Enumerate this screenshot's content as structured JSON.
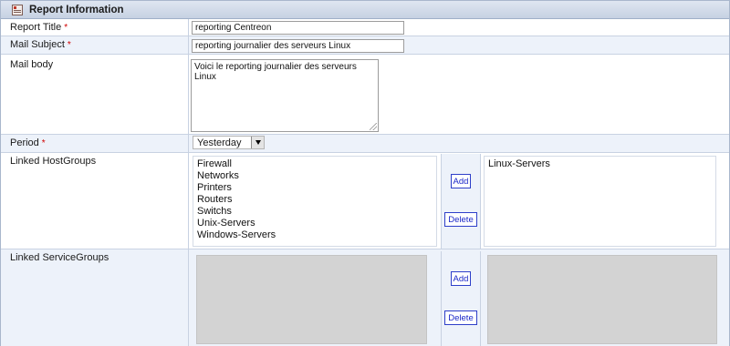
{
  "section": {
    "title": "Report Information",
    "icon": "report-icon"
  },
  "fields": {
    "report_title": {
      "label": "Report Title",
      "required": "*",
      "value": "reporting Centreon"
    },
    "mail_subject": {
      "label": "Mail Subject",
      "required": "*",
      "value": "reporting journalier des serveurs Linux"
    },
    "mail_body": {
      "label": "Mail body",
      "value": "Voici le reporting journalier des serveurs Linux"
    },
    "period": {
      "label": "Period",
      "required": "*",
      "value": "Yesterday"
    }
  },
  "hostgroups": {
    "label": "Linked HostGroups",
    "available": [
      "Firewall",
      "Networks",
      "Printers",
      "Routers",
      "Switchs",
      "Unix-Servers",
      "Windows-Servers"
    ],
    "selected": [
      "Linux-Servers"
    ],
    "add_label": "Add",
    "delete_label": "Delete"
  },
  "servicegroups": {
    "label": "Linked ServiceGroups",
    "available": [],
    "selected": [],
    "add_label": "Add",
    "delete_label": "Delete"
  },
  "colors": {
    "required": "#d00000",
    "button_text": "#1a27c8",
    "header_bg": "#c6d1e2"
  }
}
